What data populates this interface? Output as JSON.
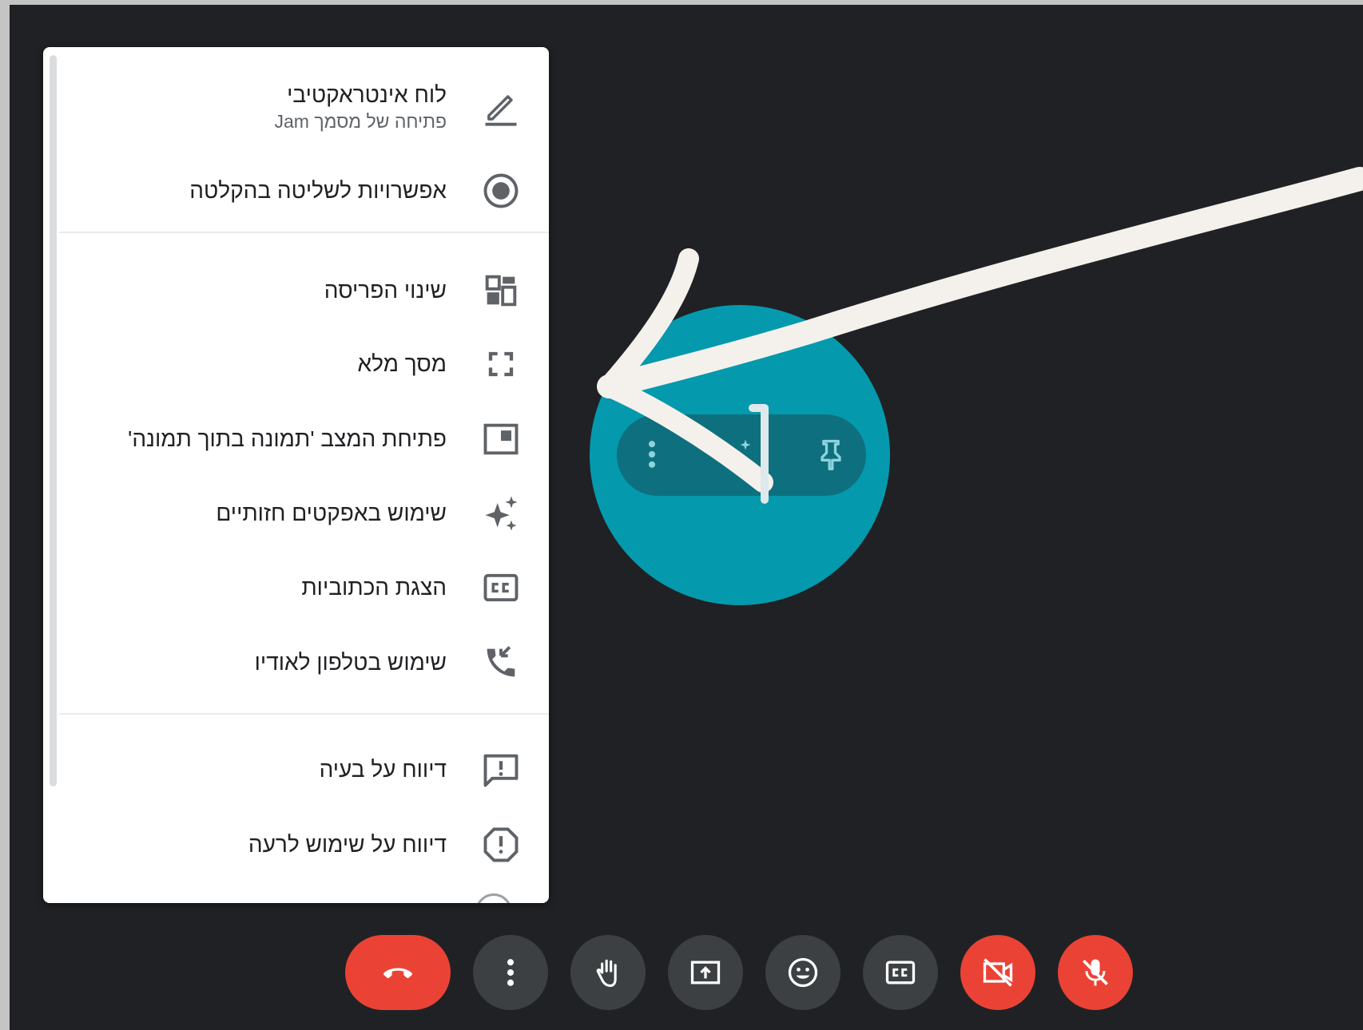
{
  "menu": {
    "items": [
      {
        "label": "לוח אינטראקטיבי",
        "sublabel": "פתיחה של מסמך Jam",
        "icon": "pen-icon"
      },
      {
        "label": "אפשרויות לשליטה בהקלטה",
        "icon": "record-icon"
      },
      {
        "label": "שינוי הפריסה",
        "icon": "layout-icon"
      },
      {
        "label": "מסך מלא",
        "icon": "fullscreen-icon"
      },
      {
        "label": "פתיחת המצב 'תמונה בתוך תמונה'",
        "icon": "picture-in-picture-icon"
      },
      {
        "label": "שימוש באפקטים חזותיים",
        "icon": "sparkle-icon"
      },
      {
        "label": "הצגת הכתוביות",
        "icon": "closed-captions-icon"
      },
      {
        "label": "שימוש בטלפון לאודיו",
        "icon": "phone-icon"
      },
      {
        "label": "דיווח על בעיה",
        "icon": "feedback-icon"
      },
      {
        "label": "דיווח על שימוש לרעה",
        "icon": "report-abuse-icon"
      }
    ]
  },
  "tile": {
    "avatar_color": "#0599ad",
    "toolbar": [
      "more-vert-icon",
      "sparkle-icon",
      "pin-icon"
    ]
  },
  "controls": [
    "hangup-icon",
    "more-vert-icon",
    "raise-hand-icon",
    "present-screen-icon",
    "emoji-icon",
    "closed-captions-icon",
    "camera-off-icon",
    "mic-off-icon"
  ],
  "colors": {
    "background": "#202124",
    "danger": "#ea4335",
    "button": "#3c4043",
    "avatar": "#0599ad"
  }
}
